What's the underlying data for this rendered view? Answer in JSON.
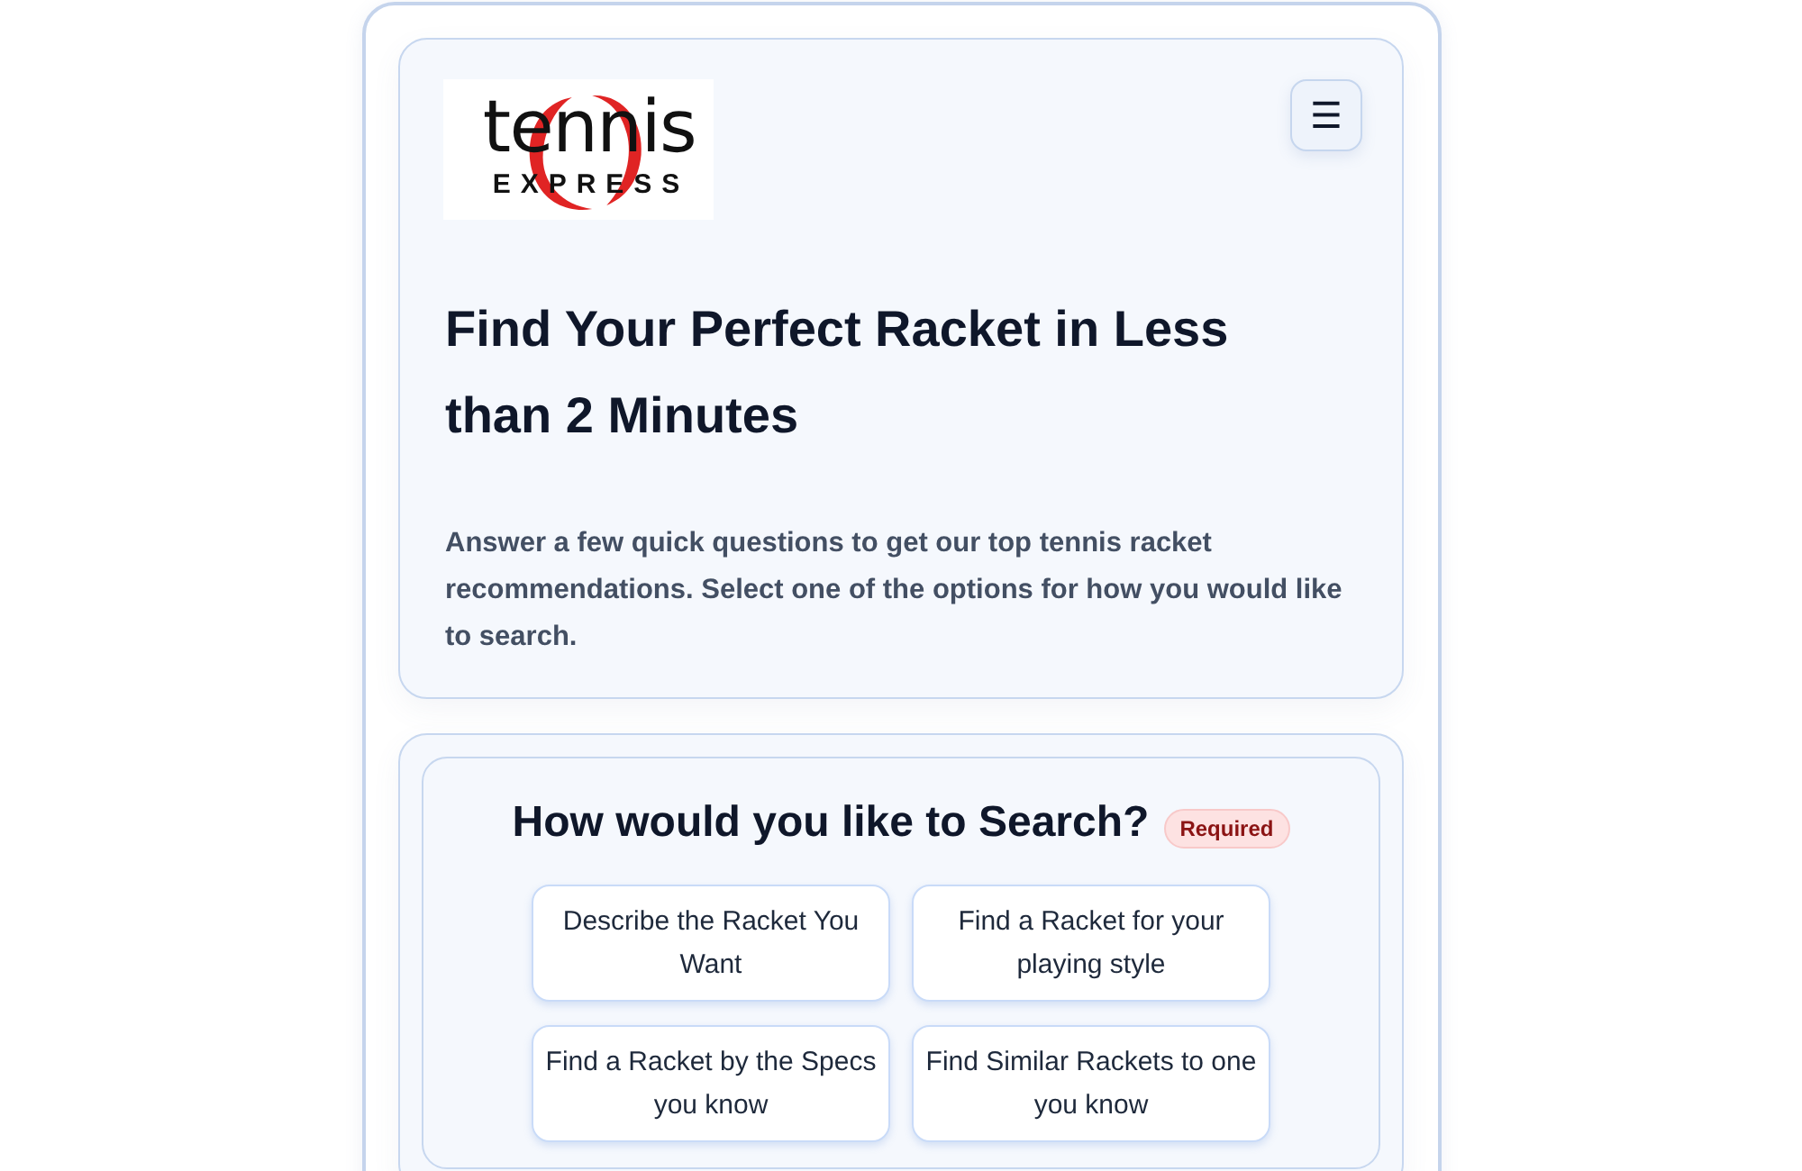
{
  "header": {
    "logo": {
      "word_top": "tennis",
      "word_bottom": "EXPRESS"
    },
    "menu_button": {
      "label": "☰"
    },
    "title": "Find Your Perfect Racket in Less than 2 Minutes",
    "intro": "Answer a few quick questions to get our top tennis racket recommendations. Select one of the options for how you would like to search."
  },
  "search_panel": {
    "heading": "How would you like to Search?",
    "badge": "Required",
    "options": [
      {
        "label": "Describe the Racket You Want",
        "selected": false
      },
      {
        "label": "Find a Racket for your playing style",
        "selected": false
      },
      {
        "label": "Find a Racket by the Specs you know",
        "selected": false
      },
      {
        "label": "Find Similar Rackets to one you know",
        "selected": false
      }
    ]
  }
}
